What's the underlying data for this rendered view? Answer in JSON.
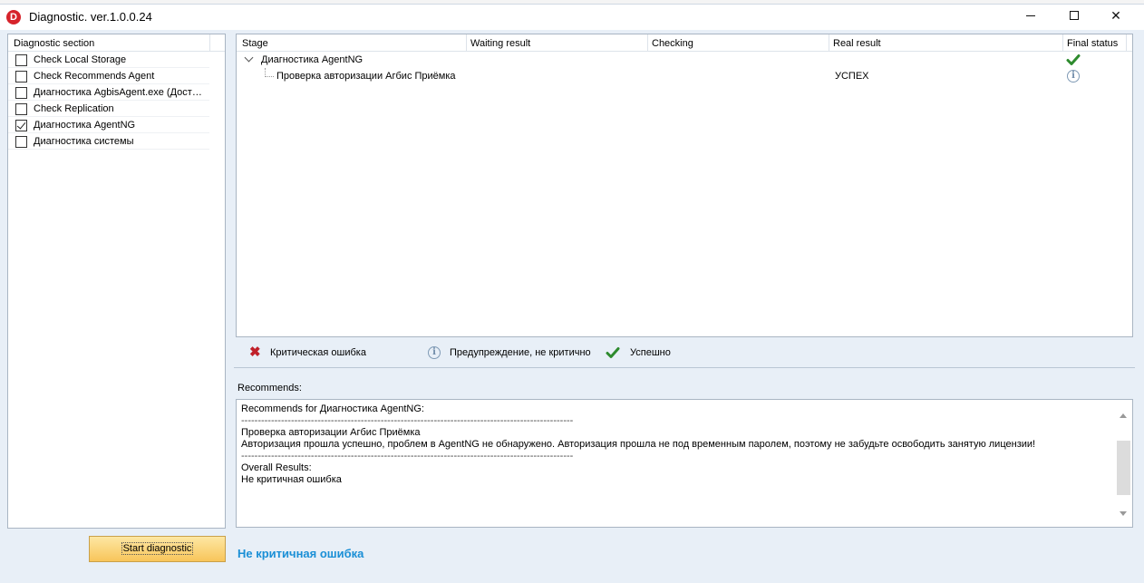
{
  "window": {
    "title": "Diagnostic. ver.1.0.0.24",
    "logo_letter": "D",
    "buttons": {
      "minimize": "minimize",
      "maximize": "maximize",
      "close": "✕"
    }
  },
  "sections": {
    "header": "Diagnostic section",
    "items": [
      {
        "label": "Check Local Storage",
        "checked": false
      },
      {
        "label": "Check Recommends Agent",
        "checked": false
      },
      {
        "label": "Диагностика AgbisAgent.exe (Дост…",
        "checked": false
      },
      {
        "label": "Check Replication",
        "checked": false
      },
      {
        "label": "Диагностика AgentNG",
        "checked": true
      },
      {
        "label": "Диагностика системы",
        "checked": false
      }
    ]
  },
  "grid": {
    "columns": [
      "Stage",
      "Waiting result",
      "Checking",
      "Real result",
      "Final status"
    ],
    "rows": [
      {
        "stage": "Диагностика AgentNG",
        "waiting": "",
        "checking": "",
        "real": "",
        "status_icon": "success-check-icon",
        "level": 0
      },
      {
        "stage": "Проверка авторизации Агбис Приёмка",
        "waiting": "",
        "checking": "",
        "real": "УСПЕХ",
        "status_icon": "warning-info-icon",
        "level": 1
      }
    ]
  },
  "legend": {
    "critical": "Критическая ошибка",
    "warning": "Предупреждение, не критично",
    "success": "Успешно"
  },
  "recommends": {
    "label": "Recommends:",
    "lines": [
      "Recommends for Диагностика AgentNG:",
      "----------------------------------------------------------------------------------------------------",
      "Проверка авторизации Агбис Приёмка",
      "Авторизация прошла успешно, проблем в AgentNG не обнаружено. Авторизация прошла не под временным паролем, поэтому не забудьте освободить занятую лицензии!",
      "----------------------------------------------------------------------------------------------------",
      "Overall Results:",
      "Не критичная ошибка"
    ]
  },
  "actions": {
    "start": "Start diagnostic"
  },
  "status": {
    "text": "Не критичная ошибка",
    "color": "#1a8fd6"
  },
  "colors": {
    "success": "#2e8b2e",
    "critical": "#c0202a",
    "accent": "#f8c55a"
  }
}
